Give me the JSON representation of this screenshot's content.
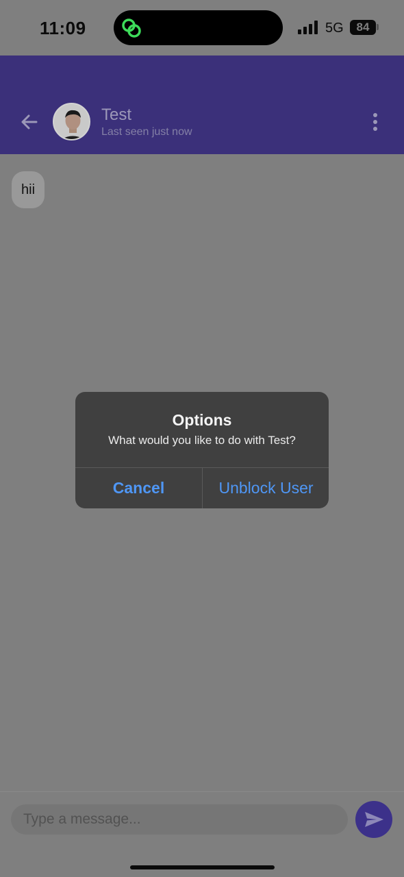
{
  "status_bar": {
    "time": "11:09",
    "network": "5G",
    "battery": "84",
    "activity_icon": "link-rings-icon",
    "activity_color": "#3ddc5a"
  },
  "header": {
    "back_icon": "arrow-left-icon",
    "contact_name": "Test",
    "contact_status": "Last seen just now",
    "more_icon": "more-vertical-icon",
    "background_color": "#3b307a"
  },
  "messages": [
    {
      "text": "hii"
    }
  ],
  "input": {
    "placeholder": "Type a message...",
    "send_icon": "send-icon"
  },
  "dialog": {
    "title": "Options",
    "message": "What would you like to do with Test?",
    "cancel_label": "Cancel",
    "unblock_label": "Unblock User",
    "accent_color": "#4f97f6"
  }
}
